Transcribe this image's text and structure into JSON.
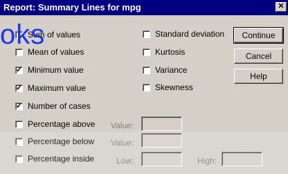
{
  "window": {
    "title": "Report: Summary Lines for mpg",
    "close_glyph": "✕"
  },
  "left_options": [
    {
      "label": "Sum of values",
      "checked": false
    },
    {
      "label": "Mean of values",
      "checked": false
    },
    {
      "label": "Minimum value",
      "checked": true
    },
    {
      "label": "Maximum value",
      "checked": true
    },
    {
      "label": "Number of cases",
      "checked": true
    },
    {
      "label": "Percentage above",
      "checked": false
    },
    {
      "label": "Percentage below",
      "checked": false
    },
    {
      "label": "Percentage inside",
      "checked": false
    }
  ],
  "right_options": [
    {
      "label": "Standard deviation",
      "checked": false
    },
    {
      "label": "Kurtosis",
      "checked": false
    },
    {
      "label": "Variance",
      "checked": false
    },
    {
      "label": "Skewness",
      "checked": false
    }
  ],
  "buttons": {
    "continue": "Continue",
    "cancel": "Cancel",
    "help": "Help"
  },
  "fields": {
    "value_label": "Value:",
    "low_label": "Low:",
    "high_label": "High:"
  },
  "overlay": {
    "text": "oks"
  },
  "check_glyph": "✓"
}
